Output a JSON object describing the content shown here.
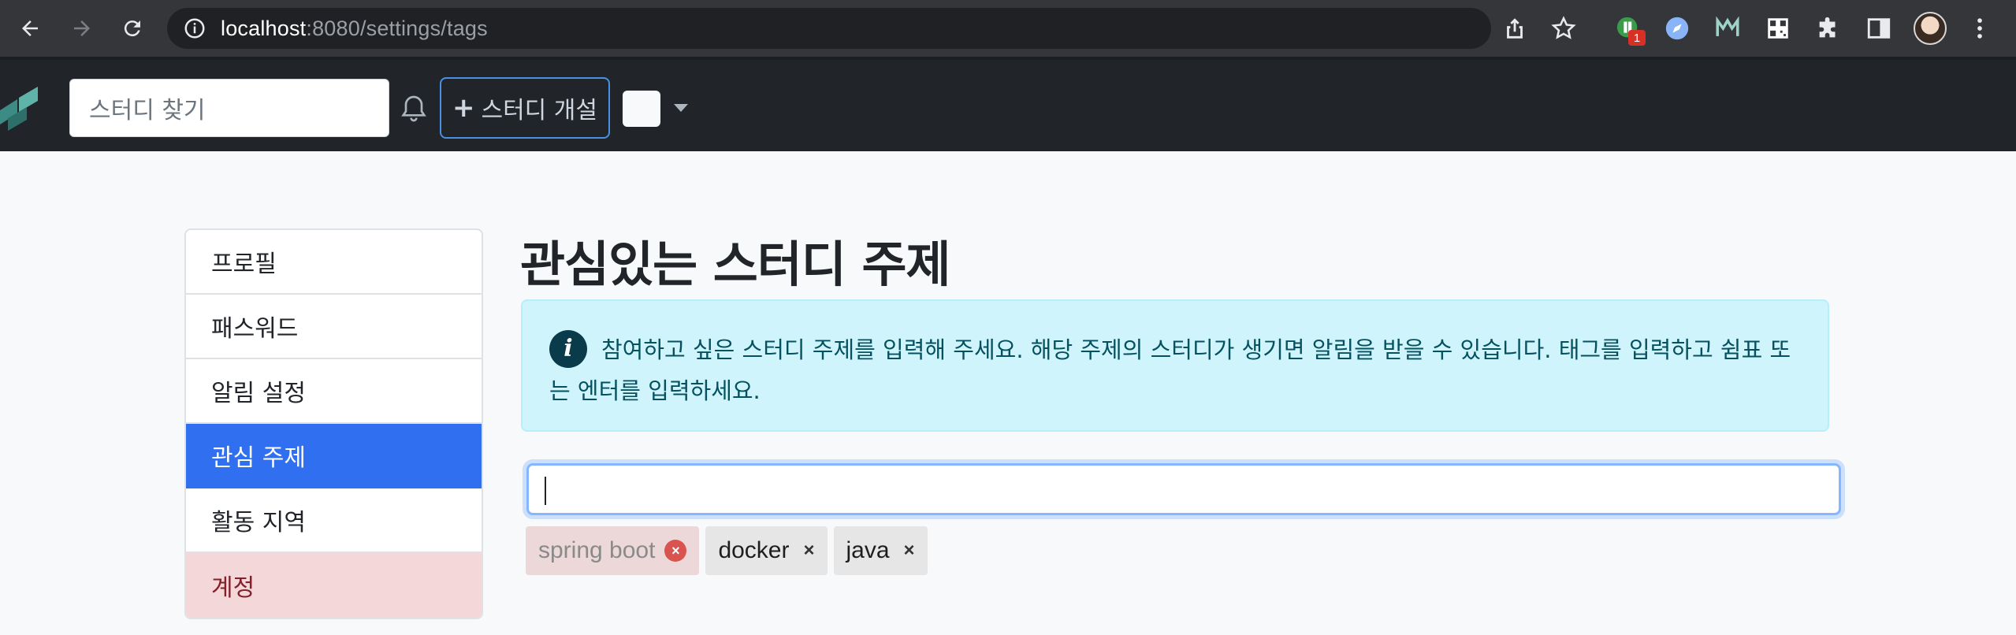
{
  "browser": {
    "url_host": "localhost",
    "url_rest": ":8080/settings/tags",
    "extension_badge": "1"
  },
  "navbar": {
    "search_placeholder": "스터디 찾기",
    "open_study_label": "스터디 개설",
    "open_study_icon": "plus-icon"
  },
  "sidebar": {
    "items": [
      {
        "label": "프로필"
      },
      {
        "label": "패스워드"
      },
      {
        "label": "알림 설정"
      },
      {
        "label": "관심 주제"
      },
      {
        "label": "활동 지역"
      },
      {
        "label": "계정"
      }
    ],
    "active_index": 3
  },
  "main": {
    "title": "관심있는 스터디 주제",
    "alert_text": "참여하고 싶은 스터디 주제를 입력해 주세요. 해당 주제의 스터디가 생기면 알림을 받을 수 있습니다. 태그를 입력하고 쉼표 또는 엔터를 입력하세요.",
    "tag_input_value": "",
    "tags": [
      {
        "label": "spring boot",
        "state": "invalid"
      },
      {
        "label": "docker",
        "state": "normal"
      },
      {
        "label": "java",
        "state": "normal"
      }
    ],
    "remove_symbol": "×"
  },
  "colors": {
    "navbar_bg": "#212529",
    "active_item": "#2f6ff0",
    "alert_bg": "#cff4fc",
    "danger_bg": "#f3d7d9"
  }
}
